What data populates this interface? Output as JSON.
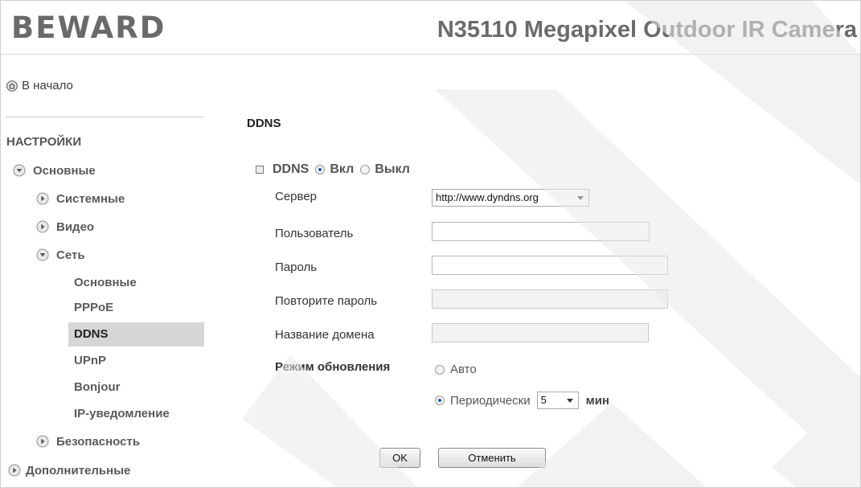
{
  "header": {
    "logo_text": "BEWARD",
    "camera_title": "N35110 Megapixel Outdoor IR Camera"
  },
  "sidebar": {
    "home_label": "В начало",
    "section_heading": "НАСТРОЙКИ",
    "basic_label": "Основные",
    "system_label": "Системные",
    "video_label": "Видео",
    "network_label": "Сеть",
    "network_items": [
      "Основные",
      "PPPoE",
      "DDNS",
      "UPnP",
      "Bonjour",
      "IP-уведомление"
    ],
    "active_item": "DDNS",
    "security_label": "Безопасность",
    "advanced_label": "Дополнительные"
  },
  "main": {
    "section_title": "DDNS",
    "ddns_label": "DDNS",
    "on_label": "Вкл",
    "off_label": "Выкл",
    "ddns_enabled": true,
    "server_label": "Сервер",
    "server_value": "http://www.dyndns.org",
    "user_label": "Пользователь",
    "user_value": "",
    "password_label": "Пароль",
    "password_value": "",
    "repeat_password_label": "Повторите пароль",
    "repeat_password_value": "",
    "domain_label": "Название домена",
    "domain_value": "",
    "update_mode_label": "Режим обновления",
    "auto_label": "Авто",
    "periodic_label": "Периодически",
    "update_mode_selected": "Периодически",
    "period_value": "5",
    "period_unit": "мин",
    "ok_label": "OK",
    "cancel_label": "Отменить"
  },
  "colors": {
    "active_nav_bg": "#d6d6d6",
    "radio_on": "#1e5bb0",
    "text_gray": "#5a5a5a"
  }
}
